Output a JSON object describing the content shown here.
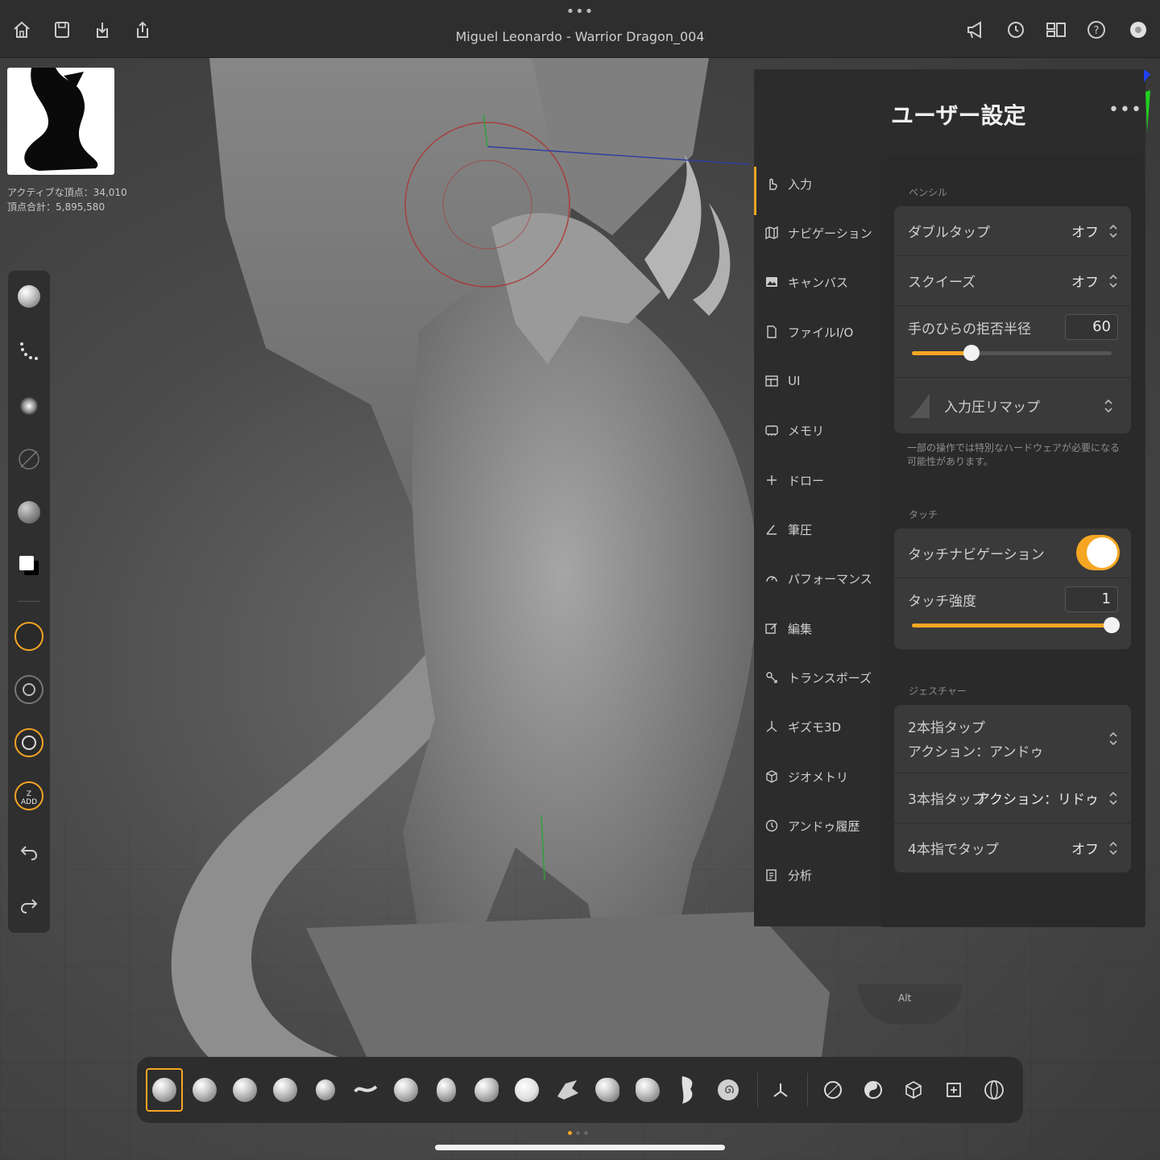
{
  "topbar": {
    "title": "Miguel Leonardo - Warrior Dragon_004"
  },
  "stats": {
    "active_vertices": "アクティブな頂点：34,010",
    "total_vertices": "頂点合計：5,895,580"
  },
  "panel": {
    "title": "ユーザー設定",
    "nav": [
      {
        "label": "入力",
        "icon": "hand-pointer-icon",
        "active": true
      },
      {
        "label": "ナビゲーション",
        "icon": "map-icon"
      },
      {
        "label": "キャンバス",
        "icon": "image-icon"
      },
      {
        "label": "ファイルI/O",
        "icon": "file-icon"
      },
      {
        "label": "UI",
        "icon": "layout-icon"
      },
      {
        "label": "メモリ",
        "icon": "memory-chip-icon"
      },
      {
        "label": "ドロー",
        "icon": "plus-icon"
      },
      {
        "label": "筆圧",
        "icon": "pen-pressure-icon"
      },
      {
        "label": "パフォーマンス",
        "icon": "gauge-icon"
      },
      {
        "label": "編集",
        "icon": "edit-icon"
      },
      {
        "label": "トランスポーズ",
        "icon": "transpose-icon"
      },
      {
        "label": "ギズモ3D",
        "icon": "gizmo-icon"
      },
      {
        "label": "ジオメトリ",
        "icon": "cube-icon"
      },
      {
        "label": "アンドゥ履歴",
        "icon": "history-icon"
      },
      {
        "label": "分析",
        "icon": "analysis-icon"
      }
    ],
    "pencil": {
      "section": "ペンシル",
      "double_tap": {
        "label": "ダブルタップ",
        "value": "オフ"
      },
      "squeeze": {
        "label": "スクイーズ",
        "value": "オフ"
      },
      "palm_radius": {
        "label": "手のひらの拒否半径",
        "value": "60",
        "fraction": 0.3
      },
      "pressure_remap": {
        "label": "入力圧リマップ"
      },
      "note": "一部の操作では特別なハードウェアが必要になる可能性があります。"
    },
    "touch": {
      "section": "タッチ",
      "touch_nav": {
        "label": "タッチナビゲーション",
        "on": true
      },
      "touch_strength": {
        "label": "タッチ強度",
        "value": "1",
        "fraction": 1.0
      }
    },
    "gesture": {
      "section": "ジェスチャー",
      "two_finger": {
        "label": "2本指タップ",
        "value": "アクション：アンドゥ"
      },
      "three_finger": {
        "label": "3本指タップ",
        "value": "アクション：リドゥ"
      },
      "four_finger": {
        "label": "4本指でタップ",
        "value": "オフ"
      }
    }
  },
  "left_tools": {
    "z_add": "Z ADD"
  },
  "viewport": {
    "alt_label": "Alt"
  },
  "colors": {
    "accent": "#f5a623",
    "panel_bg": "#2c2c2c",
    "card_bg": "#3a3a3a"
  }
}
